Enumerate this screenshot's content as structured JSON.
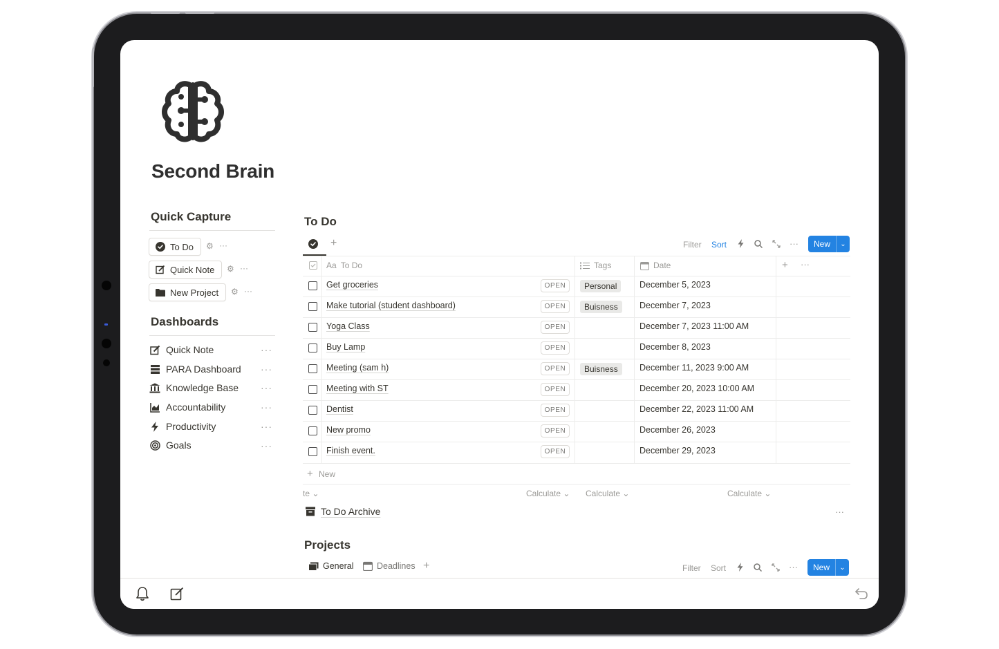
{
  "page": {
    "title": "Second Brain"
  },
  "quick_capture": {
    "heading": "Quick Capture",
    "buttons": [
      {
        "label": "To Do",
        "icon": "check-circle-icon"
      },
      {
        "label": "Quick Note",
        "icon": "edit-icon"
      },
      {
        "label": "New Project",
        "icon": "folder-icon"
      }
    ]
  },
  "dashboards": {
    "heading": "Dashboards",
    "items": [
      {
        "label": "Quick Note",
        "icon": "edit-icon"
      },
      {
        "label": "PARA Dashboard",
        "icon": "archive-drawer-icon"
      },
      {
        "label": "Knowledge Base",
        "icon": "bank-icon"
      },
      {
        "label": "Accountability",
        "icon": "chart-icon"
      },
      {
        "label": "Productivity",
        "icon": "bolt-icon"
      },
      {
        "label": "Goals",
        "icon": "target-icon"
      }
    ]
  },
  "todo_db": {
    "title": "To Do",
    "toolbar": {
      "filter": "Filter",
      "sort": "Sort",
      "new": "New"
    },
    "columns": {
      "title": "To Do",
      "title_prefix": "Aa",
      "tags": "Tags",
      "date": "Date"
    },
    "open_label": "OPEN",
    "rows": [
      {
        "title": "Get groceries",
        "tag": "Personal",
        "date": "December 5, 2023"
      },
      {
        "title": "Make tutorial (student dashboard)",
        "tag": "Buisness",
        "date": "December 7, 2023"
      },
      {
        "title": "Yoga Class",
        "tag": "",
        "date": "December 7, 2023 11:00 AM"
      },
      {
        "title": "Buy Lamp",
        "tag": "",
        "date": "December 8, 2023"
      },
      {
        "title": "Meeting (sam h)",
        "tag": "Buisness",
        "date": "December 11, 2023 9:00 AM"
      },
      {
        "title": "Meeting with ST",
        "tag": "",
        "date": "December 20, 2023 10:00 AM"
      },
      {
        "title": "Dentist",
        "tag": "",
        "date": "December 22, 2023 11:00 AM"
      },
      {
        "title": "New promo",
        "tag": "",
        "date": "December 26, 2023"
      },
      {
        "title": "Finish event.",
        "tag": "",
        "date": "December 29, 2023"
      }
    ],
    "add_new": "New",
    "footer": {
      "partial": "te",
      "calc1": "Calculate",
      "calc2": "Calculate",
      "calc3": "Calculate"
    },
    "archive": "To Do Archive"
  },
  "projects_db": {
    "title": "Projects",
    "tabs": [
      {
        "label": "General"
      },
      {
        "label": "Deadlines"
      }
    ],
    "toolbar": {
      "filter": "Filter",
      "sort": "Sort",
      "new": "New"
    }
  },
  "colors": {
    "accent": "#2383e2",
    "text": "#37352f",
    "muted": "#9b9a97",
    "tag_bg": "#e9e9e7"
  }
}
